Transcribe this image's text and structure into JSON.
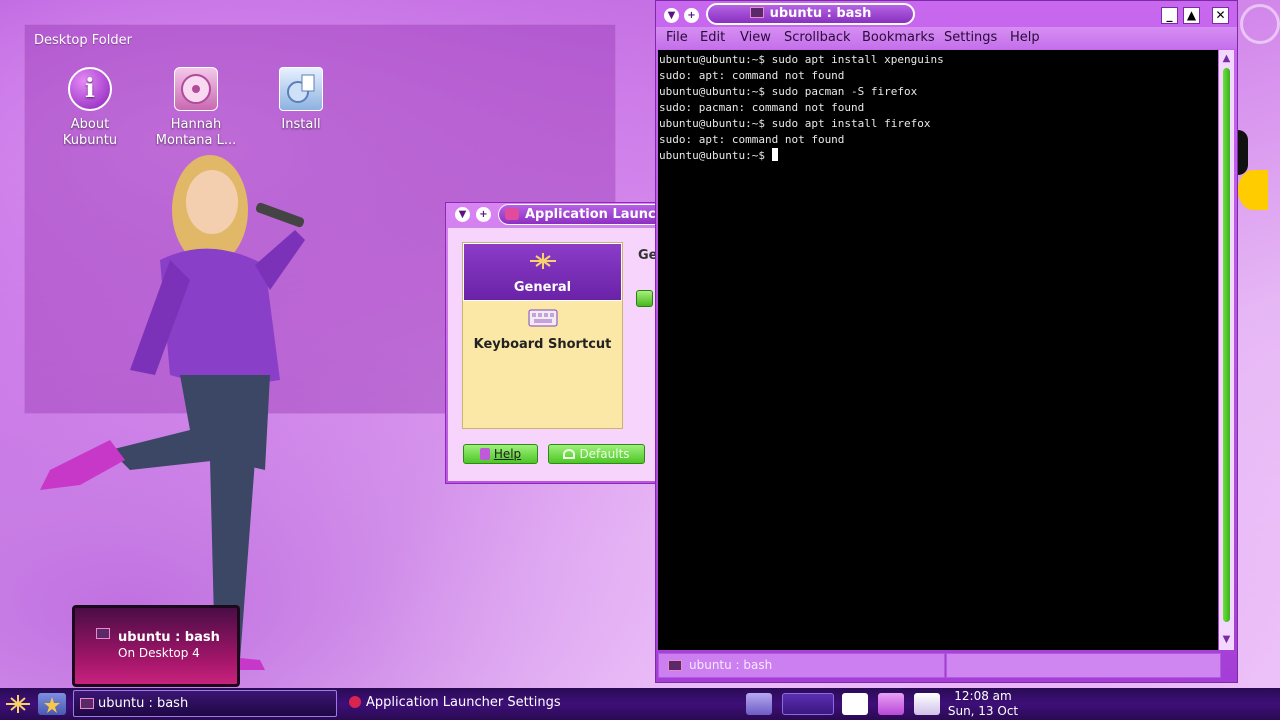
{
  "desktop": {
    "folder_title": "Desktop Folder",
    "icons": [
      {
        "label_line1": "About",
        "label_line2": "Kubuntu",
        "icon": "info-icon"
      },
      {
        "label_line1": "Hannah",
        "label_line2": "Montana L...",
        "icon": "disc-icon"
      },
      {
        "label_line1": "Install",
        "label_line2": "",
        "icon": "install-icon"
      }
    ]
  },
  "launcher_settings": {
    "title": "Application Launch",
    "list_items": [
      "General",
      "Keyboard Shortcut"
    ],
    "general_heading": "Ge",
    "help_label": "Help",
    "defaults_label": "Defaults"
  },
  "terminal": {
    "title": "ubuntu : bash",
    "menu": [
      "File",
      "Edit",
      "View",
      "Scrollback",
      "Bookmarks",
      "Settings",
      "Help"
    ],
    "lines": [
      "ubuntu@ubuntu:~$ sudo apt install xpenguins",
      "sudo: apt: command not found",
      "ubuntu@ubuntu:~$ sudo pacman -S firefox",
      "sudo: pacman: command not found",
      "ubuntu@ubuntu:~$ sudo apt install firefox",
      "sudo: apt: command not found"
    ],
    "prompt": "ubuntu@ubuntu:~$ ",
    "tab_label": "ubuntu : bash"
  },
  "notification": {
    "title": "ubuntu : bash",
    "subtitle": "On Desktop 4"
  },
  "taskbar": {
    "tasks": [
      "ubuntu : bash",
      "Application Launcher Settings"
    ],
    "clock_time": "12:08 am",
    "clock_date": "Sun, 13 Oct"
  },
  "colors": {
    "accent": "#9a3fd0",
    "taskbar": "#2f0d62",
    "button_green": "#4dc626"
  }
}
